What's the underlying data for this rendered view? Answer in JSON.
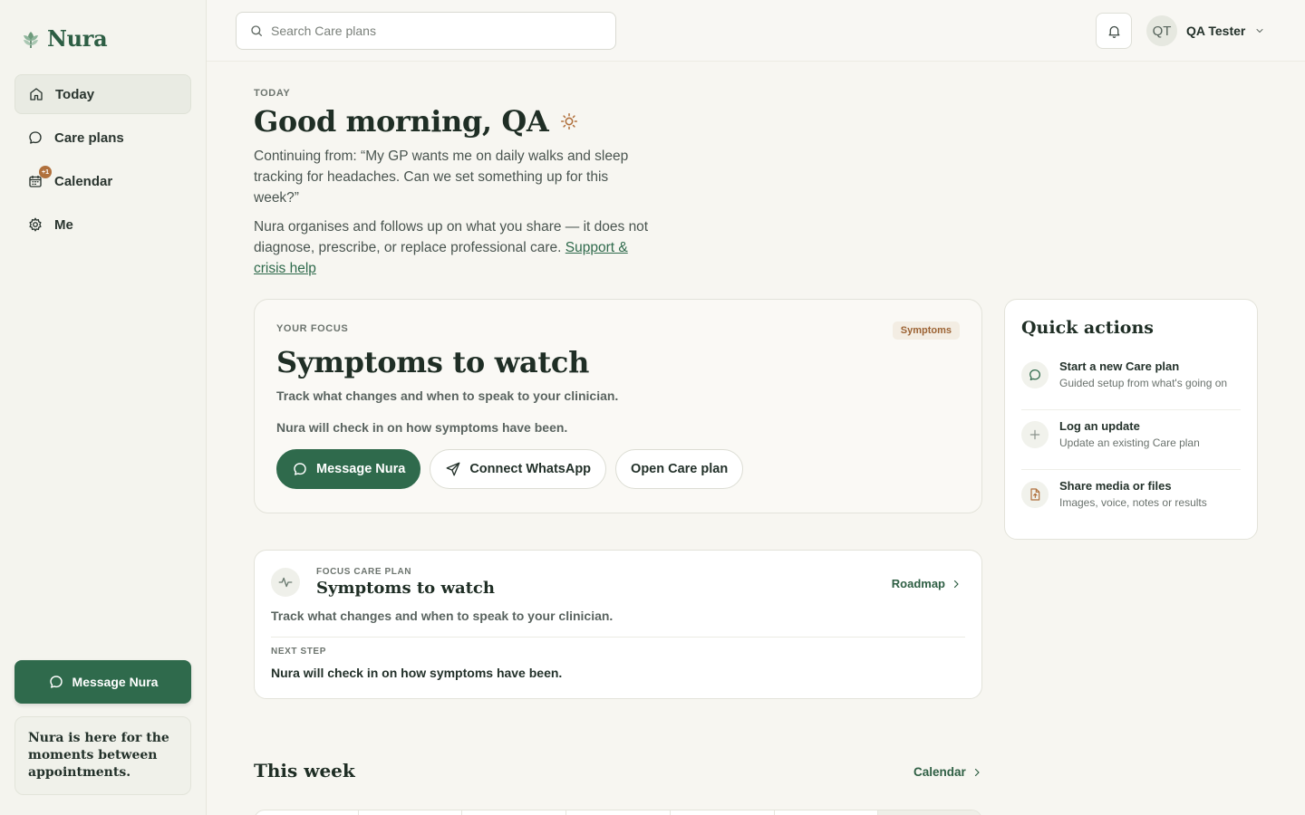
{
  "app": {
    "name": "Nura"
  },
  "sidebar": {
    "items": [
      {
        "label": "Today",
        "icon": "home-icon",
        "active": true
      },
      {
        "label": "Care plans",
        "icon": "chat-icon",
        "active": false
      },
      {
        "label": "Calendar",
        "icon": "calendar-icon",
        "active": false,
        "badge": "+1"
      },
      {
        "label": "Me",
        "icon": "gear-icon",
        "active": false
      }
    ],
    "cta_label": "Message Nura",
    "note": "Nura is here for the moments between appointments."
  },
  "header": {
    "search_placeholder": "Search Care plans",
    "user_initials": "QT",
    "user_name": "QA Tester"
  },
  "greeting": {
    "eyebrow": "TODAY",
    "title": "Good morning, QA",
    "continuing": "Continuing from: “My GP wants me on daily walks and sleep tracking for headaches. Can we set something up for this week?”",
    "disclaimer": "Nura organises and follows up on what you share — it does not diagnose, prescribe, or replace professional care.",
    "support_link": "Support & crisis help"
  },
  "focus": {
    "eyebrow": "YOUR FOCUS",
    "tag": "Symptoms",
    "title": "Symptoms to watch",
    "subtitle": "Track what changes and when to speak to your clinician.",
    "note": "Nura will check in on how symptoms have been.",
    "buttons": {
      "message": "Message Nura",
      "whatsapp": "Connect WhatsApp",
      "open": "Open Care plan"
    }
  },
  "quick_actions": {
    "title": "Quick actions",
    "items": [
      {
        "title": "Start a new Care plan",
        "subtitle": "Guided setup from what's going on",
        "icon": "chat-icon"
      },
      {
        "title": "Log an update",
        "subtitle": "Update an existing Care plan",
        "icon": "plus-icon"
      },
      {
        "title": "Share media or files",
        "subtitle": "Images, voice, notes or results",
        "icon": "file-upload-icon"
      }
    ]
  },
  "plan": {
    "eyebrow": "FOCUS CARE PLAN",
    "title": "Symptoms to watch",
    "link": "Roadmap",
    "subtitle": "Track what changes and when to speak to your clinician.",
    "next_label": "NEXT STEP",
    "next": "Nura will check in on how symptoms have been."
  },
  "week": {
    "title": "This week",
    "link": "Calendar"
  },
  "colors": {
    "brand": "#2f6a4c",
    "accent": "#b0703c",
    "background": "#f7f6f1"
  }
}
